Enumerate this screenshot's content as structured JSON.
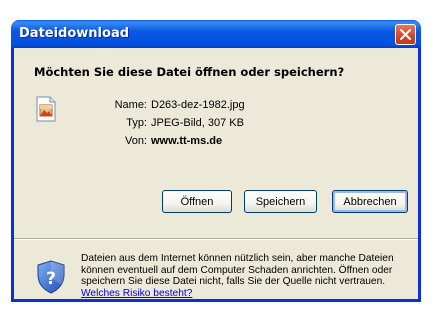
{
  "dialog": {
    "title": "Dateidownload",
    "question": "Möchten Sie diese Datei öffnen oder speichern?"
  },
  "file": {
    "name_label": "Name:",
    "name_value": "D263-dez-1982.jpg",
    "type_label": "Typ:",
    "type_value": "JPEG-Bild, 307 KB",
    "from_label": "Von:",
    "from_value": "www.tt-ms.de",
    "icon": "jpeg-file-icon"
  },
  "buttons": {
    "open": "Öffnen",
    "save": "Speichern",
    "cancel": "Abbrechen"
  },
  "warning": {
    "icon": "shield-question-icon",
    "text": "Dateien aus dem Internet können nützlich sein, aber manche Dateien können eventuell auf dem Computer Schaden anrichten. Öffnen oder speichern Sie diese Datei nicht, falls Sie der Quelle nicht vertrauen. ",
    "link": "Welches Risiko besteht?"
  },
  "colors": {
    "titlebar": "#0a58e3",
    "client": "#ece9d8",
    "close_button": "#d24a2a",
    "link": "#0000ff"
  }
}
